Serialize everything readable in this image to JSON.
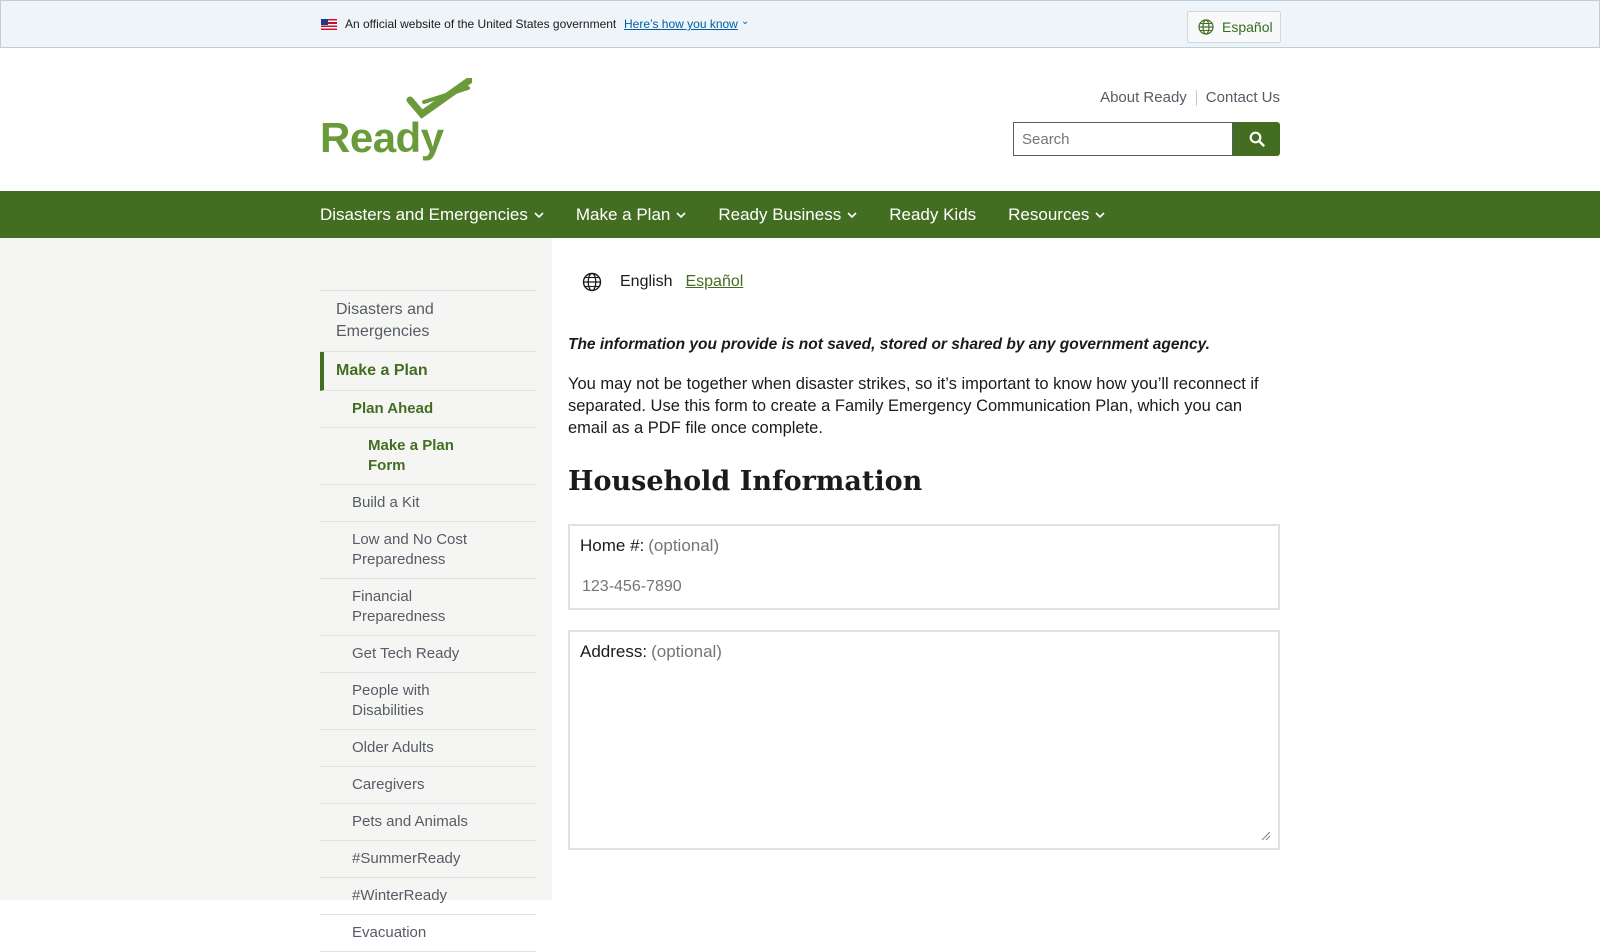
{
  "gov_banner": {
    "text": "An official website of the United States government",
    "link": "Here’s how you know",
    "language_button": "Español"
  },
  "header": {
    "logo_text": "Ready",
    "util_links": [
      "About Ready",
      "Contact Us"
    ],
    "search_placeholder": "Search"
  },
  "nav": {
    "items": [
      {
        "label": "Disasters and Emergencies",
        "dropdown": true
      },
      {
        "label": "Make a Plan",
        "dropdown": true
      },
      {
        "label": "Ready Business",
        "dropdown": true
      },
      {
        "label": "Ready Kids",
        "dropdown": false
      },
      {
        "label": "Resources",
        "dropdown": true
      }
    ]
  },
  "sidenav": {
    "items": [
      {
        "label": "Disasters and Emergencies",
        "level": 1
      },
      {
        "label": "Make a Plan",
        "level": 1,
        "current": true
      },
      {
        "label": "Plan Ahead",
        "level": 2,
        "active": true
      },
      {
        "label": "Make a Plan Form",
        "level": 3,
        "active": true
      },
      {
        "label": "Build a Kit",
        "level": 2
      },
      {
        "label": "Low and No Cost Preparedness",
        "level": 2
      },
      {
        "label": "Financial Preparedness",
        "level": 2
      },
      {
        "label": "Get Tech Ready",
        "level": 2
      },
      {
        "label": "People with Disabilities",
        "level": 2
      },
      {
        "label": "Older Adults",
        "level": 2
      },
      {
        "label": "Caregivers",
        "level": 2
      },
      {
        "label": "Pets and Animals",
        "level": 2
      },
      {
        "label": "#SummerReady",
        "level": 2
      },
      {
        "label": "#WinterReady",
        "level": 2
      },
      {
        "label": "Evacuation",
        "level": 2
      }
    ]
  },
  "main": {
    "lang_current": "English",
    "lang_other": "Español",
    "notice": "The information you provide is not saved, stored or shared by any government agency.",
    "intro": "You may not be together when disaster strikes, so it’s important to know how you’ll reconnect if separated. Use this form to create a Family Emergency Communication Plan, which you can email as a PDF file once complete.",
    "section_title": "Household Information",
    "home_label": "Home #:",
    "home_optional": "(optional)",
    "home_placeholder": "123-456-7890",
    "address_label": "Address:",
    "address_optional": "(optional)"
  },
  "colors": {
    "brand_green": "#436e22",
    "logo_green": "#6a9a3a",
    "gov_link_blue": "#005ea2"
  }
}
